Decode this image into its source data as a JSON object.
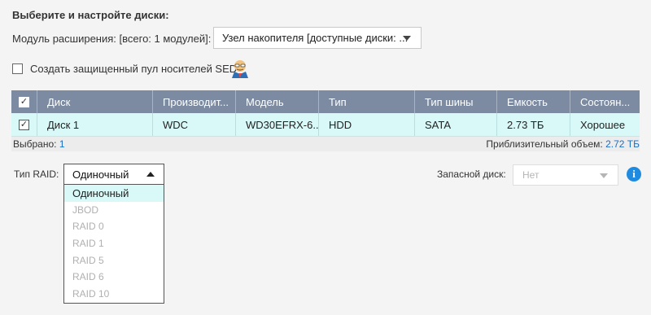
{
  "heading": "Выберите и настройте диски:",
  "module": {
    "label": "Модуль расширения: [всего: 1 модулей]:",
    "selected": "Узел накопителя [доступные диски: ..."
  },
  "sed": {
    "label": "Создать защищенный пул носителей SED",
    "checked": false
  },
  "table": {
    "headers": [
      "",
      "Диск",
      "Производит...",
      "Модель",
      "Тип",
      "Тип шины",
      "Емкость",
      "Состоян..."
    ],
    "rows": [
      {
        "checked": true,
        "cells": [
          "Диск 1",
          "WDC",
          "WD30EFRX-6...",
          "HDD",
          "SATA",
          "2.73 ТБ",
          "Хорошее"
        ]
      }
    ],
    "footer": {
      "selected_label": "Выбрано:",
      "selected_value": "1",
      "capacity_label": "Приблизительный объем:",
      "capacity_value": "2.72 ТБ"
    }
  },
  "raid": {
    "label": "Тип RAID:",
    "selected": "Одиночный",
    "options": [
      "Одиночный",
      "JBOD",
      "RAID 0",
      "RAID 1",
      "RAID 5",
      "RAID 6",
      "RAID 10"
    ]
  },
  "spare": {
    "label": "Запасной диск:",
    "selected": "Нет"
  },
  "colors": {
    "header_bg": "#7c8ba1",
    "selected_row_bg": "#d9f9f9",
    "link_blue": "#1a6fc2",
    "info_blue": "#1e8be0"
  }
}
